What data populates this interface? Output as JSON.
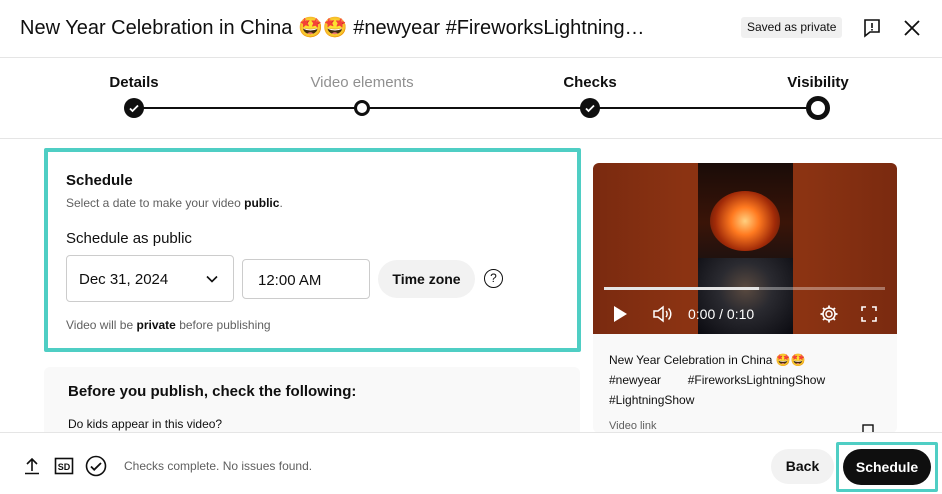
{
  "header": {
    "title": "New Year Celebration in China 🤩🤩 #newyear        #FireworksLightning…",
    "saved_badge": "Saved as private",
    "feedback_icon": "feedback-icon",
    "close_icon": "close-icon"
  },
  "stepper": {
    "steps": [
      {
        "label": "Details",
        "state": "done"
      },
      {
        "label": "Video elements",
        "state": "open"
      },
      {
        "label": "Checks",
        "state": "done"
      },
      {
        "label": "Visibility",
        "state": "current"
      }
    ]
  },
  "schedule": {
    "title": "Schedule",
    "subtitle_pre": "Select a date to make your video ",
    "subtitle_bold": "public",
    "subtitle_post": ".",
    "field_label": "Schedule as public",
    "date_value": "Dec 31, 2024",
    "time_value": "12:00 AM",
    "timezone_button": "Time zone",
    "help_glyph": "?",
    "note_pre": "Video will be ",
    "note_bold": "private",
    "note_post": " before publishing"
  },
  "checklist": {
    "title": "Before you publish, check the following:",
    "question": "Do kids appear in this video?"
  },
  "video": {
    "time": "0:00 / 0:10",
    "progress_fraction": 0.55,
    "title_line": "New Year Celebration in China 🤩🤩",
    "tags_line": "#newyear        #FireworksLightningShow",
    "tags_line2": "#LightningShow",
    "link_label": "Video link"
  },
  "footer": {
    "status": "Checks complete. No issues found.",
    "back_label": "Back",
    "schedule_label": "Schedule"
  },
  "colors": {
    "accent_highlight": "#4fcec4",
    "primary_button": "#0f0f0f"
  }
}
